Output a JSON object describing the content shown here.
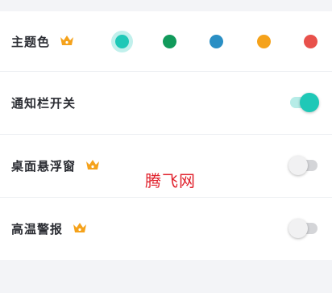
{
  "colors": {
    "background": "#f3f4f7",
    "card": "#ffffff",
    "accent": "#1fc8b7",
    "crown": "#f5a21b",
    "label": "#2b2d33",
    "watermark": "#e0202b"
  },
  "theme": {
    "label": "主题色",
    "premium_icon": "crown-icon",
    "swatches": [
      {
        "name": "teal",
        "color": "#1fc8b7",
        "selected": true
      },
      {
        "name": "green",
        "color": "#119a5b",
        "selected": false
      },
      {
        "name": "blue",
        "color": "#2a8fc4",
        "selected": false
      },
      {
        "name": "orange",
        "color": "#f5a21b",
        "selected": false
      },
      {
        "name": "red",
        "color": "#e8514b",
        "selected": false
      }
    ]
  },
  "settings": [
    {
      "label": "通知栏开关",
      "premium": false,
      "enabled": true
    },
    {
      "label": "桌面悬浮窗",
      "premium": true,
      "enabled": false
    },
    {
      "label": "高温警报",
      "premium": true,
      "enabled": false
    }
  ],
  "watermark": "腾飞网"
}
